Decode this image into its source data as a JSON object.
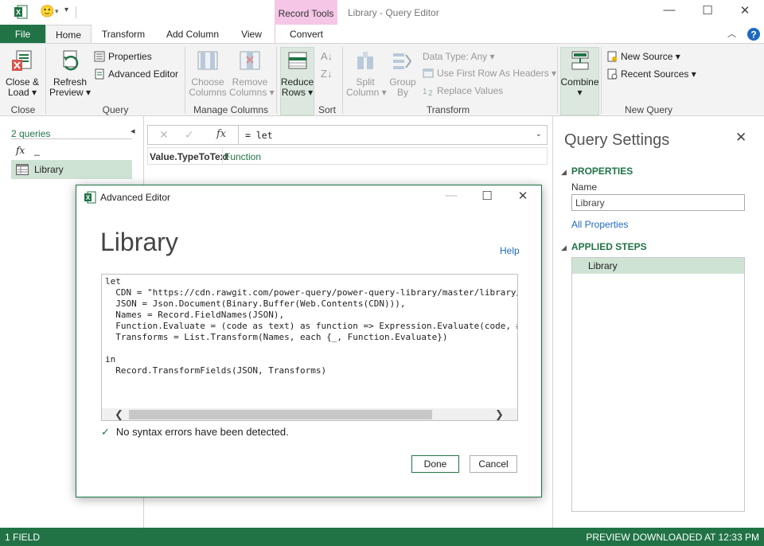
{
  "window": {
    "contextual_tab_group": "Record Tools",
    "title": "Library - Query Editor",
    "smiley": "🙂",
    "qat_dropdown": "▾"
  },
  "tabs": {
    "file": "File",
    "home": "Home",
    "transform": "Transform",
    "add_column": "Add Column",
    "view": "View",
    "convert": "Convert"
  },
  "ribbon": {
    "close_group": {
      "label": "Close",
      "close_load": "Close &\nLoad ▾"
    },
    "query_group": {
      "label": "Query",
      "refresh": "Refresh\nPreview ▾",
      "properties": "Properties",
      "advanced_editor": "Advanced Editor"
    },
    "manage_columns_group": {
      "label": "Manage Columns",
      "choose": "Choose\nColumns",
      "remove": "Remove\nColumns ▾"
    },
    "sort_group": {
      "label": "Sort",
      "reduce": "Reduce\nRows ▾"
    },
    "transform_group": {
      "label": "Transform",
      "split": "Split\nColumn ▾",
      "group_by": "Group\nBy",
      "data_type": "Data Type: Any ▾",
      "first_row": "Use First Row As Headers ▾",
      "replace": "Replace Values"
    },
    "combine_group": {
      "combine": "Combine\n▾"
    },
    "new_query_group": {
      "label": "New Query",
      "new_source": "New Source ▾",
      "recent_sources": "Recent Sources ▾"
    }
  },
  "left_pane": {
    "count": "2 queries",
    "collapse_glyph": "◂",
    "items": [
      {
        "label": "_",
        "icon": "fx-icon"
      },
      {
        "label": "Library",
        "icon": "table-icon"
      }
    ]
  },
  "formula_bar": {
    "cancel": "✕",
    "commit": "✓",
    "fx": "fx",
    "text": "= let",
    "expand": "⌄"
  },
  "record": {
    "key": "Value.TypeToText",
    "value": "Function"
  },
  "query_settings": {
    "title": "Query Settings",
    "close": "✕",
    "properties_heading": "PROPERTIES",
    "name_label": "Name",
    "name_value": "Library",
    "all_properties": "All Properties",
    "applied_steps_heading": "APPLIED STEPS",
    "steps": [
      "Library"
    ]
  },
  "status": {
    "left": "1 FIELD",
    "right": "PREVIEW DOWNLOADED AT 12:33 PM"
  },
  "dialog": {
    "title": "Advanced Editor",
    "heading": "Library",
    "help": "Help",
    "code": "let\n  CDN = \"https://cdn.rawgit.com/power-query/power-query-library/master/library/\n  JSON = Json.Document(Binary.Buffer(Web.Contents(CDN))),\n  Names = Record.FieldNames(JSON),\n  Function.Evaluate = (code as text) as function => Expression.Evaluate(code, #\n  Transforms = List.Transform(Names, each {_, Function.Evaluate})\n\nin\n  Record.TransformFields(JSON, Transforms)",
    "syntax_status": "No syntax errors have been detected.",
    "done": "Done",
    "cancel": "Cancel",
    "minimize": "—",
    "maximize": "☐",
    "close": "✕"
  },
  "colors": {
    "accent": "#217346",
    "contextual": "#f5c6e6",
    "link": "#1f6ac1",
    "selection": "#cfe3d4"
  }
}
